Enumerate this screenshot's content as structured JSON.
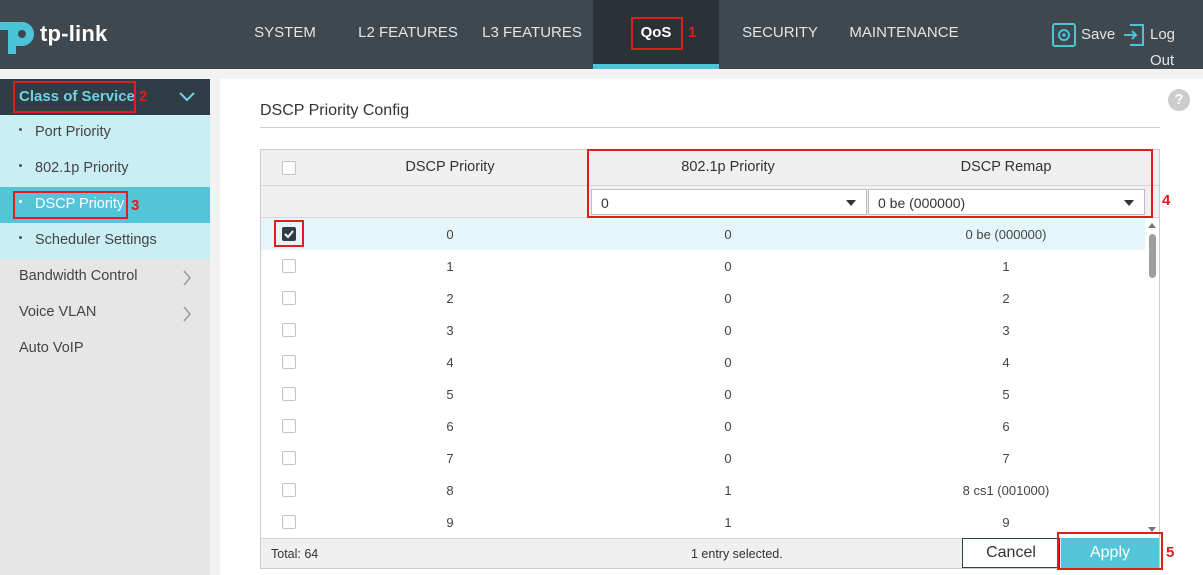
{
  "header": {
    "brand": "tp-link",
    "nav": [
      "SYSTEM",
      "L2 FEATURES",
      "L3 FEATURES",
      "QoS",
      "SECURITY",
      "MAINTENANCE"
    ],
    "save_label": "Save",
    "logout_label": "Log Out",
    "brand_color": "#4dc3d7",
    "save_icon": "save-gear-icon",
    "logout_icon": "logout-icon"
  },
  "annotations": [
    "1",
    "2",
    "3",
    "4",
    "5"
  ],
  "sidebar": {
    "section": "Class of Service",
    "sub_items": [
      "Port Priority",
      "802.1p Priority",
      "DSCP Priority",
      "Scheduler Settings"
    ],
    "items": [
      "Bandwidth Control",
      "Voice VLAN",
      "Auto VoIP"
    ]
  },
  "main": {
    "title": "DSCP Priority Config",
    "help": "?",
    "columns": [
      "DSCP Priority",
      "802.1p Priority",
      "DSCP Remap"
    ],
    "filter": {
      "priority_value": "0",
      "remap_value": "0 be (000000)"
    },
    "rows": [
      {
        "dscp": "0",
        "priority": "0",
        "remap": "0 be (000000)",
        "checked": true
      },
      {
        "dscp": "1",
        "priority": "0",
        "remap": "1",
        "checked": false
      },
      {
        "dscp": "2",
        "priority": "0",
        "remap": "2",
        "checked": false
      },
      {
        "dscp": "3",
        "priority": "0",
        "remap": "3",
        "checked": false
      },
      {
        "dscp": "4",
        "priority": "0",
        "remap": "4",
        "checked": false
      },
      {
        "dscp": "5",
        "priority": "0",
        "remap": "5",
        "checked": false
      },
      {
        "dscp": "6",
        "priority": "0",
        "remap": "6",
        "checked": false
      },
      {
        "dscp": "7",
        "priority": "0",
        "remap": "7",
        "checked": false
      },
      {
        "dscp": "8",
        "priority": "1",
        "remap": "8 cs1 (001000)",
        "checked": false
      },
      {
        "dscp": "9",
        "priority": "1",
        "remap": "9",
        "checked": false
      }
    ],
    "total": "Total: 64",
    "selected": "1 entry selected.",
    "cancel_label": "Cancel",
    "apply_label": "Apply"
  }
}
